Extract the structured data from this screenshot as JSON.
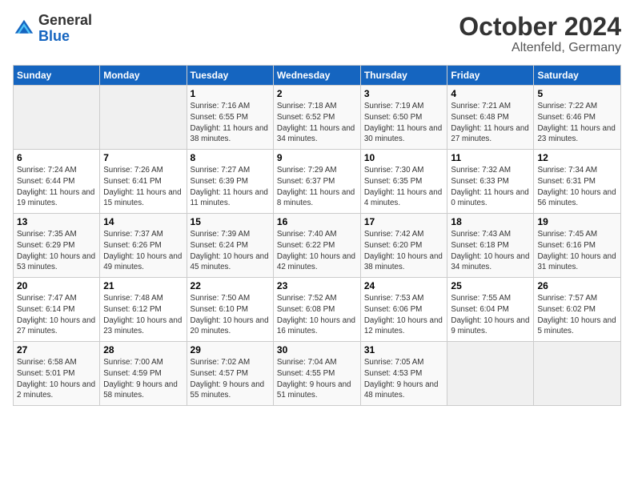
{
  "header": {
    "logo_general": "General",
    "logo_blue": "Blue",
    "month": "October 2024",
    "location": "Altenfeld, Germany"
  },
  "weekdays": [
    "Sunday",
    "Monday",
    "Tuesday",
    "Wednesday",
    "Thursday",
    "Friday",
    "Saturday"
  ],
  "weeks": [
    [
      {
        "day": "",
        "info": ""
      },
      {
        "day": "",
        "info": ""
      },
      {
        "day": "1",
        "info": "Sunrise: 7:16 AM\nSunset: 6:55 PM\nDaylight: 11 hours and 38 minutes."
      },
      {
        "day": "2",
        "info": "Sunrise: 7:18 AM\nSunset: 6:52 PM\nDaylight: 11 hours and 34 minutes."
      },
      {
        "day": "3",
        "info": "Sunrise: 7:19 AM\nSunset: 6:50 PM\nDaylight: 11 hours and 30 minutes."
      },
      {
        "day": "4",
        "info": "Sunrise: 7:21 AM\nSunset: 6:48 PM\nDaylight: 11 hours and 27 minutes."
      },
      {
        "day": "5",
        "info": "Sunrise: 7:22 AM\nSunset: 6:46 PM\nDaylight: 11 hours and 23 minutes."
      }
    ],
    [
      {
        "day": "6",
        "info": "Sunrise: 7:24 AM\nSunset: 6:44 PM\nDaylight: 11 hours and 19 minutes."
      },
      {
        "day": "7",
        "info": "Sunrise: 7:26 AM\nSunset: 6:41 PM\nDaylight: 11 hours and 15 minutes."
      },
      {
        "day": "8",
        "info": "Sunrise: 7:27 AM\nSunset: 6:39 PM\nDaylight: 11 hours and 11 minutes."
      },
      {
        "day": "9",
        "info": "Sunrise: 7:29 AM\nSunset: 6:37 PM\nDaylight: 11 hours and 8 minutes."
      },
      {
        "day": "10",
        "info": "Sunrise: 7:30 AM\nSunset: 6:35 PM\nDaylight: 11 hours and 4 minutes."
      },
      {
        "day": "11",
        "info": "Sunrise: 7:32 AM\nSunset: 6:33 PM\nDaylight: 11 hours and 0 minutes."
      },
      {
        "day": "12",
        "info": "Sunrise: 7:34 AM\nSunset: 6:31 PM\nDaylight: 10 hours and 56 minutes."
      }
    ],
    [
      {
        "day": "13",
        "info": "Sunrise: 7:35 AM\nSunset: 6:29 PM\nDaylight: 10 hours and 53 minutes."
      },
      {
        "day": "14",
        "info": "Sunrise: 7:37 AM\nSunset: 6:26 PM\nDaylight: 10 hours and 49 minutes."
      },
      {
        "day": "15",
        "info": "Sunrise: 7:39 AM\nSunset: 6:24 PM\nDaylight: 10 hours and 45 minutes."
      },
      {
        "day": "16",
        "info": "Sunrise: 7:40 AM\nSunset: 6:22 PM\nDaylight: 10 hours and 42 minutes."
      },
      {
        "day": "17",
        "info": "Sunrise: 7:42 AM\nSunset: 6:20 PM\nDaylight: 10 hours and 38 minutes."
      },
      {
        "day": "18",
        "info": "Sunrise: 7:43 AM\nSunset: 6:18 PM\nDaylight: 10 hours and 34 minutes."
      },
      {
        "day": "19",
        "info": "Sunrise: 7:45 AM\nSunset: 6:16 PM\nDaylight: 10 hours and 31 minutes."
      }
    ],
    [
      {
        "day": "20",
        "info": "Sunrise: 7:47 AM\nSunset: 6:14 PM\nDaylight: 10 hours and 27 minutes."
      },
      {
        "day": "21",
        "info": "Sunrise: 7:48 AM\nSunset: 6:12 PM\nDaylight: 10 hours and 23 minutes."
      },
      {
        "day": "22",
        "info": "Sunrise: 7:50 AM\nSunset: 6:10 PM\nDaylight: 10 hours and 20 minutes."
      },
      {
        "day": "23",
        "info": "Sunrise: 7:52 AM\nSunset: 6:08 PM\nDaylight: 10 hours and 16 minutes."
      },
      {
        "day": "24",
        "info": "Sunrise: 7:53 AM\nSunset: 6:06 PM\nDaylight: 10 hours and 12 minutes."
      },
      {
        "day": "25",
        "info": "Sunrise: 7:55 AM\nSunset: 6:04 PM\nDaylight: 10 hours and 9 minutes."
      },
      {
        "day": "26",
        "info": "Sunrise: 7:57 AM\nSunset: 6:02 PM\nDaylight: 10 hours and 5 minutes."
      }
    ],
    [
      {
        "day": "27",
        "info": "Sunrise: 6:58 AM\nSunset: 5:01 PM\nDaylight: 10 hours and 2 minutes."
      },
      {
        "day": "28",
        "info": "Sunrise: 7:00 AM\nSunset: 4:59 PM\nDaylight: 9 hours and 58 minutes."
      },
      {
        "day": "29",
        "info": "Sunrise: 7:02 AM\nSunset: 4:57 PM\nDaylight: 9 hours and 55 minutes."
      },
      {
        "day": "30",
        "info": "Sunrise: 7:04 AM\nSunset: 4:55 PM\nDaylight: 9 hours and 51 minutes."
      },
      {
        "day": "31",
        "info": "Sunrise: 7:05 AM\nSunset: 4:53 PM\nDaylight: 9 hours and 48 minutes."
      },
      {
        "day": "",
        "info": ""
      },
      {
        "day": "",
        "info": ""
      }
    ]
  ]
}
